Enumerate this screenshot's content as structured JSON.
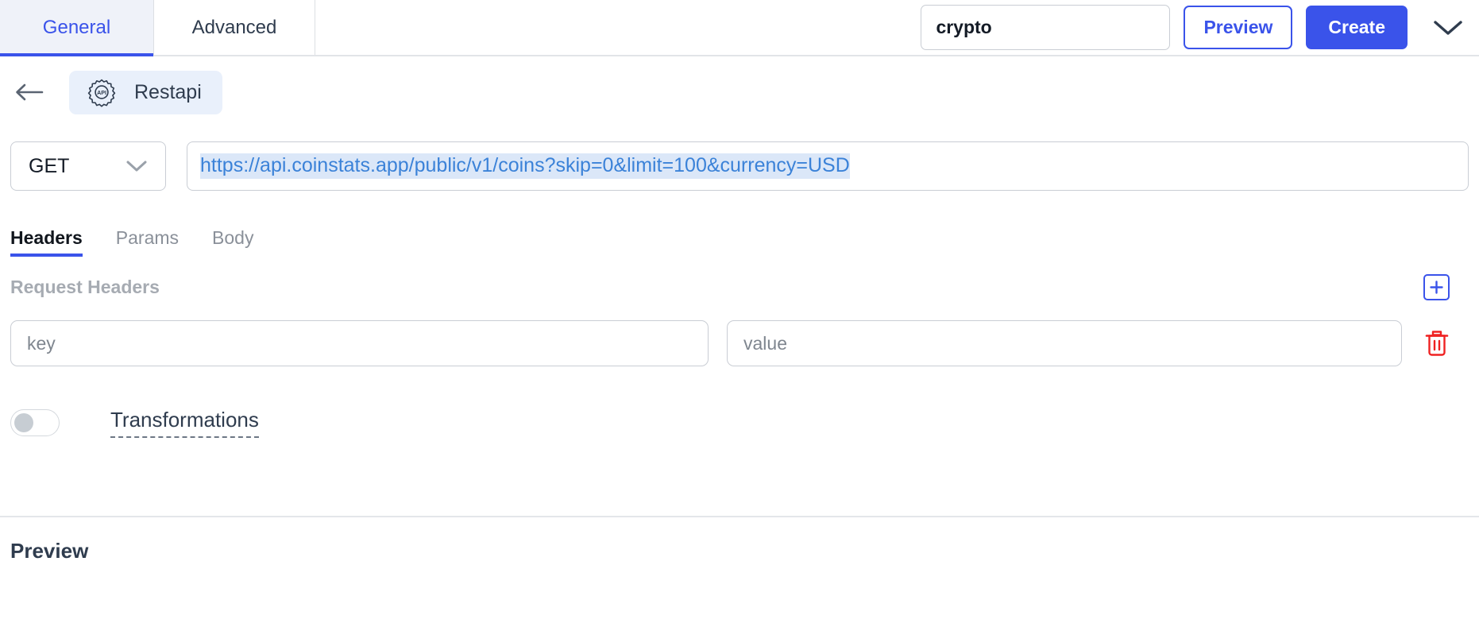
{
  "topbar": {
    "tabs": [
      {
        "label": "General",
        "active": true
      },
      {
        "label": "Advanced",
        "active": false
      }
    ],
    "name_field": {
      "value": "crypto",
      "placeholder": "name"
    },
    "preview_button": "Preview",
    "create_button": "Create",
    "collapse_icon": "chevron-down-icon"
  },
  "breadcrumb": {
    "back_icon": "arrow-left-icon",
    "chip_icon": "api-gear-icon",
    "chip_label": "Restapi"
  },
  "request": {
    "method": "GET",
    "method_chevron": "chevron-down-icon",
    "url": "https://api.coinstats.app/public/v1/coins?skip=0&limit=100&currency=USD"
  },
  "subtabs": [
    {
      "label": "Headers",
      "active": true
    },
    {
      "label": "Params",
      "active": false
    },
    {
      "label": "Body",
      "active": false
    }
  ],
  "headers_section": {
    "label": "Request Headers",
    "add_icon": "plus-icon",
    "rows": [
      {
        "key_placeholder": "key",
        "key_value": "",
        "value_placeholder": "value",
        "value_value": "",
        "delete_icon": "trash-icon"
      }
    ]
  },
  "transformations": {
    "enabled": false,
    "label": "Transformations"
  },
  "footer": {
    "preview_title": "Preview"
  },
  "colors": {
    "accent": "#3a53ea",
    "active_tab_bg": "#eff2f9",
    "chip_bg": "#e9f0fb",
    "url_text": "#3b82d8",
    "url_selection": "#dbe7f8",
    "danger": "#ef2222",
    "muted_text": "#a6abb2"
  }
}
